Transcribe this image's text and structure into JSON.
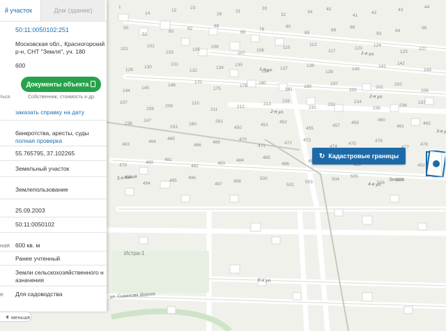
{
  "tabs": {
    "active": "й участок",
    "inactive": "Дом (здание)"
  },
  "panel": {
    "cadastral_number": "50:11:0050102:251",
    "address_line1": "Московская обл., Красногорский",
    "address_line2": "р-н, СНТ \"Земля\", уч. 180",
    "area_value": "600",
    "side_text": "ться",
    "documents_button": "Документы объекта",
    "documents_caption": "Собственник, стоимость и др.",
    "order_link": "заказать справку на дату",
    "bankruptcy_text": "банкротства, аресты, суды",
    "full_check_link": "полная проверка",
    "coordinates": "55.765795, 37.102265",
    "category": "Земельный участок",
    "type": "Землепользование",
    "date": "25.09.2003",
    "quarter": "50:11:0050102",
    "area_left_label": "ная",
    "area_full": "600 кв. м",
    "status": "Ранее учтенный",
    "land_category_line1": "Земли сельскохозяйственного н",
    "land_category_line2": "азначения",
    "use_left_label": "е",
    "use_value": "Для садоводства"
  },
  "less_button": "меньше",
  "cadastral_button": "Кадастровые границы",
  "map": {
    "street_labels": [
      "1-я ул.",
      "1-я ул.",
      "2-я ул.",
      "2-я ул.",
      "3-я ул.",
      "3-я линия",
      "4-я ул.",
      "6-я ул.",
      "ул. Симанова Дорога",
      "Истра-1",
      "Земля"
    ],
    "plot_numbers": [
      "1",
      "14",
      "15",
      "23",
      "26",
      "31",
      "30",
      "32",
      "34",
      "40",
      "41",
      "42",
      "43",
      "44",
      "50",
      "51",
      "60",
      "62",
      "68",
      "69",
      "76",
      "80",
      "85",
      "86",
      "88",
      "93",
      "94",
      "96",
      "101",
      "102",
      "103",
      "105",
      "106",
      "107",
      "108",
      "110",
      "113",
      "117",
      "123",
      "124",
      "125",
      "127",
      "128",
      "130",
      "131",
      "132",
      "134",
      "135",
      "136",
      "137",
      "138",
      "139",
      "140",
      "141",
      "142",
      "143",
      "144",
      "145",
      "146",
      "170",
      "175",
      "178",
      "180",
      "181",
      "189",
      "197",
      "200",
      "201",
      "202",
      "206",
      "207",
      "208",
      "209",
      "210",
      "211",
      "212",
      "213",
      "228",
      "231",
      "232",
      "234",
      "235",
      "236",
      "237",
      "238",
      "247",
      "253",
      "280",
      "281",
      "450",
      "451",
      "452",
      "455",
      "457",
      "459",
      "460",
      "461",
      "462",
      "463",
      "464",
      "465",
      "466",
      "469",
      "470",
      "471",
      "472",
      "473",
      "474",
      "475",
      "476",
      "477",
      "478",
      "479",
      "480",
      "481",
      "482",
      "483",
      "484",
      "485",
      "486",
      "487",
      "488",
      "489",
      "490",
      "491",
      "492",
      "493",
      "494",
      "495",
      "496",
      "497",
      "498",
      "500",
      "502",
      "503",
      "504",
      "505",
      "506",
      "507"
    ],
    "accent_color": "#1e6aa8",
    "green_button_color": "#27a24b"
  }
}
